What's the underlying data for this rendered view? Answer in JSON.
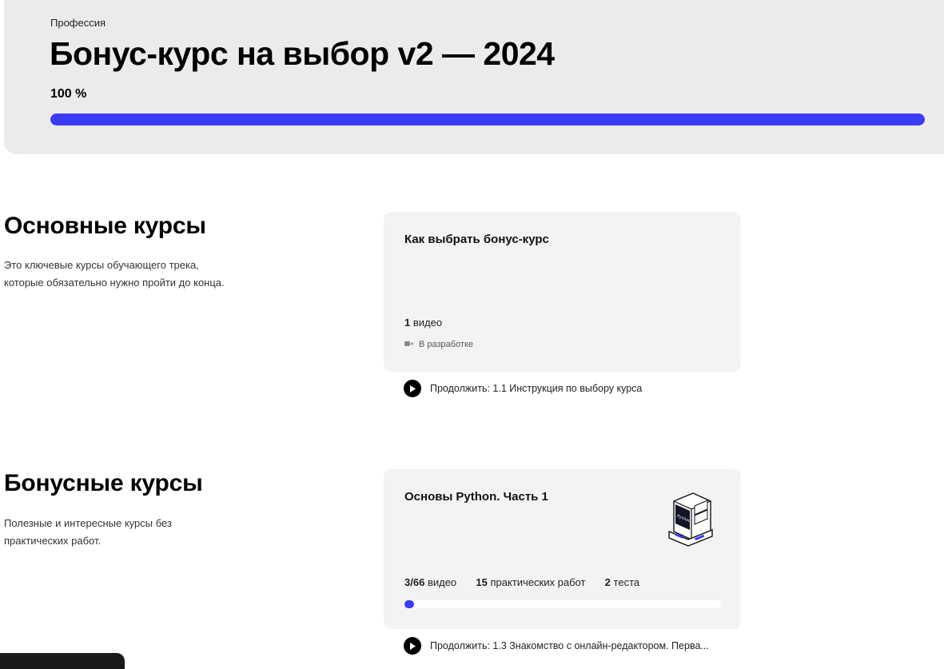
{
  "header": {
    "eyebrow": "Профессия",
    "title": "Бонус-курс на выбор v2 — 2024",
    "progress_text": "100 %",
    "progress_fraction": 1.0,
    "accent_color": "#3b3bf6"
  },
  "sections": [
    {
      "title": "Основные курсы",
      "description_lines": [
        "Это ключевые курсы обучающего трека,",
        "которые обязательно нужно пройти до конца."
      ],
      "card": {
        "title": "Как выбрать бонус-курс",
        "stats": [
          {
            "value": "1",
            "label": "видео"
          }
        ],
        "status_icon": "video-camera-icon",
        "status": "В разработке"
      },
      "continue": {
        "icon": "play-icon",
        "text": "Продолжить: 1.1 Инструкция по выбору курса"
      }
    },
    {
      "title": "Бонусные курсы",
      "description_lines": [
        "Полезные и интересные курсы без",
        "практических работ."
      ],
      "card": {
        "title": "Основы Python. Часть 1",
        "illustration": "computer-illustration",
        "stats": [
          {
            "value": "3/66",
            "label": "видео"
          },
          {
            "value": "15",
            "label": "практических работ"
          },
          {
            "value": "2",
            "label": "теста"
          }
        ],
        "progress_fraction": 0.03
      },
      "continue": {
        "icon": "play-icon",
        "text": "Продолжить: 1.3 Знакомство с онлайн-редактором. Перва..."
      }
    }
  ]
}
